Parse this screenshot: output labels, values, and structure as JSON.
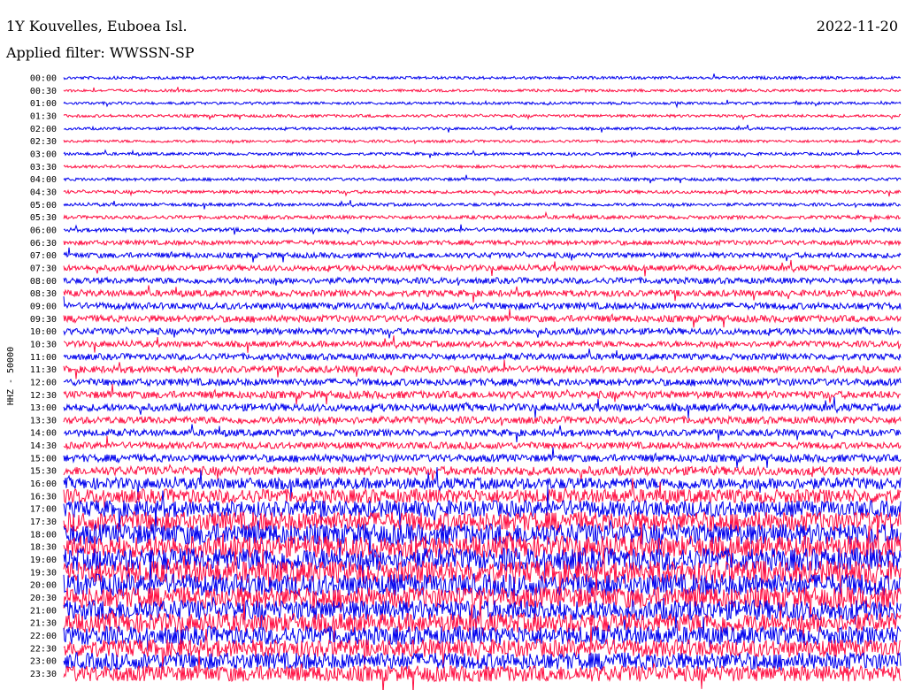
{
  "header": {
    "title": "1Y Kouvelles, Euboea Isl.",
    "date": "2022-11-20",
    "filter": "Applied filter: WWSSN-SP"
  },
  "chart_data": {
    "type": "line",
    "title": "1Y Kouvelles, Euboea Isl.",
    "ylabel": "HHZ - 50000",
    "row_labels": [
      "00:00",
      "00:30",
      "01:00",
      "01:30",
      "02:00",
      "02:30",
      "03:00",
      "03:30",
      "04:00",
      "04:30",
      "05:00",
      "05:30",
      "06:00",
      "06:30",
      "07:00",
      "07:30",
      "08:00",
      "08:30",
      "09:00",
      "09:30",
      "10:00",
      "10:30",
      "11:00",
      "11:30",
      "12:00",
      "12:30",
      "13:00",
      "13:30",
      "14:00",
      "14:30",
      "15:00",
      "15:30",
      "16:00",
      "16:30",
      "17:00",
      "17:30",
      "18:00",
      "18:30",
      "19:00",
      "19:30",
      "20:00",
      "20:30",
      "21:00",
      "21:30",
      "22:00",
      "22:30",
      "23:00",
      "23:30"
    ],
    "trace_colors": [
      "#0000ee",
      "#ff1144"
    ],
    "noise_amplitude": [
      1.6,
      1.5,
      1.5,
      1.6,
      1.5,
      1.5,
      1.6,
      1.6,
      1.7,
      1.8,
      1.8,
      2.0,
      2.2,
      2.6,
      3.0,
      3.2,
      3.4,
      3.6,
      3.8,
      3.8,
      3.6,
      3.4,
      3.6,
      3.8,
      4.0,
      4.2,
      4.2,
      4.0,
      3.8,
      3.8,
      4.2,
      5.0,
      6.5,
      8.0,
      9.5,
      11,
      12,
      12.5,
      13,
      13,
      12.5,
      12,
      11.5,
      11,
      10.5,
      10,
      9.5,
      9
    ]
  }
}
